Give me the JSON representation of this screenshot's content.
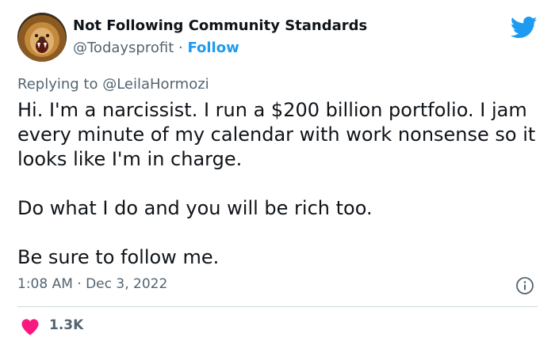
{
  "author": {
    "display_name": "Not Following Community Standards",
    "handle": "@Todaysprofit",
    "separator": " · ",
    "follow_label": "Follow",
    "avatar_icon": "lion-avatar"
  },
  "brand": {
    "icon": "twitter-bird-icon",
    "color": "#1d9bf0"
  },
  "reply": {
    "prefix": "Replying to ",
    "handle": "@LeilaHormozi"
  },
  "tweet": {
    "paragraphs": [
      "Hi. I'm a narcissist. I run a $200 billion portfolio.  I jam every minute of my calendar with work nonsense so it looks like I'm in charge.",
      "Do what I do and you will be rich too.",
      "Be sure to follow me."
    ]
  },
  "meta": {
    "timestamp": "1:08 AM · Dec 3, 2022",
    "info_icon": "info-icon"
  },
  "actions": {
    "like_icon": "heart-icon",
    "like_color": "#f91880",
    "like_count": "1.3K"
  }
}
